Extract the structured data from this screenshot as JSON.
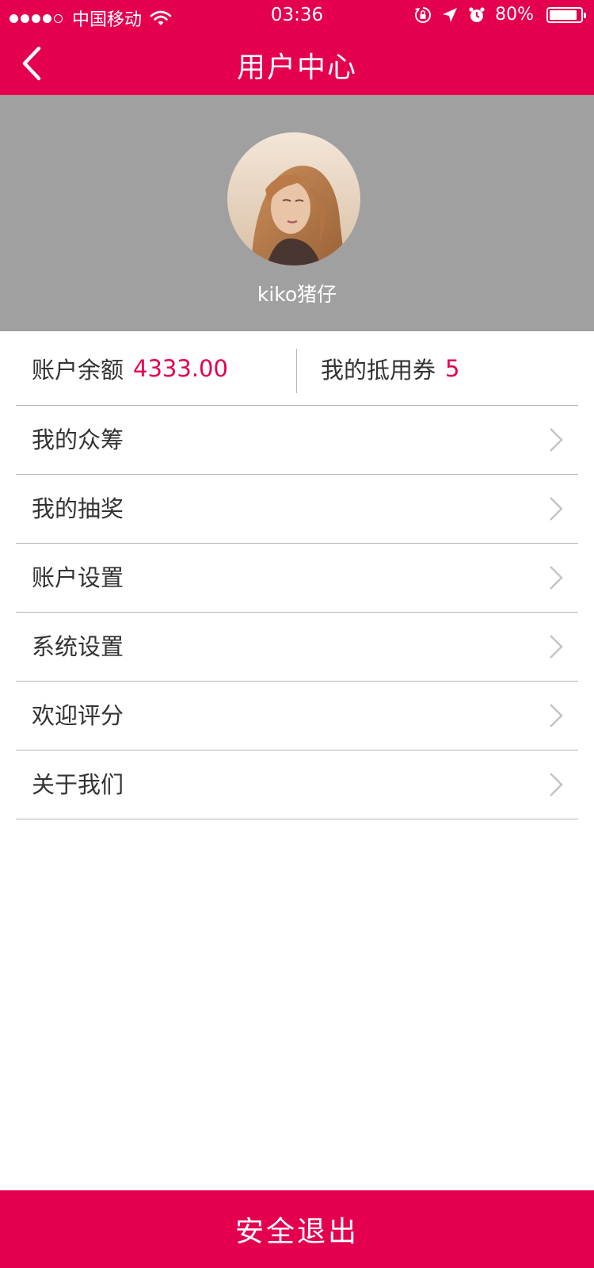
{
  "status_bar": {
    "signal_dots_filled": 4,
    "signal_dots_total": 5,
    "carrier": "中国移动",
    "time": "03:36",
    "battery_percent_label": "80%",
    "battery_level": 0.8,
    "icons": [
      "wifi-icon",
      "rotation-lock-icon",
      "location-arrow-icon",
      "alarm-icon",
      "battery-icon"
    ]
  },
  "header": {
    "title": "用户中心",
    "back_icon": "chevron-left-icon"
  },
  "profile": {
    "username": "kiko猪仔",
    "avatar_icon": "avatar-photo"
  },
  "account": {
    "balance_label": "账户余额",
    "balance_value": "4333.00",
    "coupon_label": "我的抵用券",
    "coupon_value": "5"
  },
  "menu": {
    "items": [
      {
        "label": "我的众筹"
      },
      {
        "label": "我的抽奖"
      },
      {
        "label": "账户设置"
      },
      {
        "label": "系统设置"
      },
      {
        "label": "欢迎评分"
      },
      {
        "label": "关于我们"
      }
    ],
    "item_icon": "chevron-right-icon"
  },
  "footer": {
    "logout_label": "安全退出"
  },
  "colors": {
    "accent": "#e4004f",
    "profile_bg": "#a0a0a0",
    "divider": "#b5b5b5",
    "text": "#333333"
  }
}
